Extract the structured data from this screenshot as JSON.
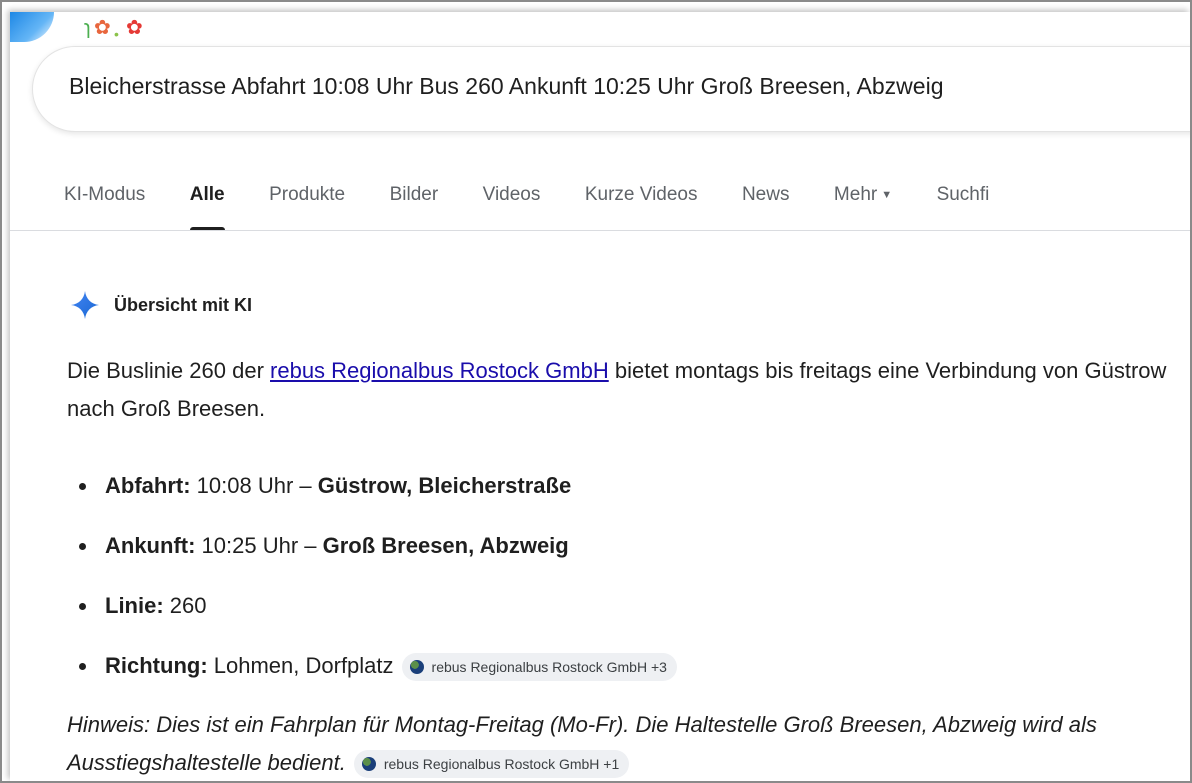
{
  "search": {
    "query": "Bleicherstrasse Abfahrt 10:08 Uhr Bus 260 Ankunft 10:25 Uhr Groß Breesen, Abzweig"
  },
  "tabs": [
    {
      "label": "KI-Modus",
      "active": false
    },
    {
      "label": "Alle",
      "active": true
    },
    {
      "label": "Produkte",
      "active": false
    },
    {
      "label": "Bilder",
      "active": false
    },
    {
      "label": "Videos",
      "active": false
    },
    {
      "label": "Kurze Videos",
      "active": false
    },
    {
      "label": "News",
      "active": false
    },
    {
      "label": "Mehr",
      "active": false
    },
    {
      "label": "Suchfi",
      "active": false
    }
  ],
  "ai_overview": {
    "title": "Übersicht mit KI",
    "intro_before": "Die Buslinie 260 der ",
    "intro_link": "rebus Regionalbus Rostock GmbH",
    "intro_after": " bietet montags bis freitags eine Verbindung von Güstrow nach Groß Breesen.",
    "bullets": [
      {
        "label": "Abfahrt:",
        "value": " 10:08 Uhr – ",
        "bold_value": "Güstrow, Bleicherstraße"
      },
      {
        "label": "Ankunft:",
        "value": " 10:25 Uhr – ",
        "bold_value": "Groß Breesen, Abzweig"
      },
      {
        "label": "Linie:",
        "value": " 260",
        "bold_value": ""
      },
      {
        "label": "Richtung:",
        "value": " Lohmen, Dorfplatz",
        "bold_value": "",
        "chip": "rebus Regionalbus Rostock GmbH +3"
      }
    ],
    "note": "Hinweis: Dies ist ein Fahrplan für Montag-Freitag (Mo-Fr). Die Haltestelle Groß Breesen, Abzweig wird als Ausstiegshaltestelle bedient.",
    "note_chip": "rebus Regionalbus Rostock GmbH +1"
  },
  "colors": {
    "link": "#1a0dab",
    "sparkle": "#1a73e8",
    "chip_bg": "#eef0f3",
    "tab_inactive": "#5f6368"
  }
}
